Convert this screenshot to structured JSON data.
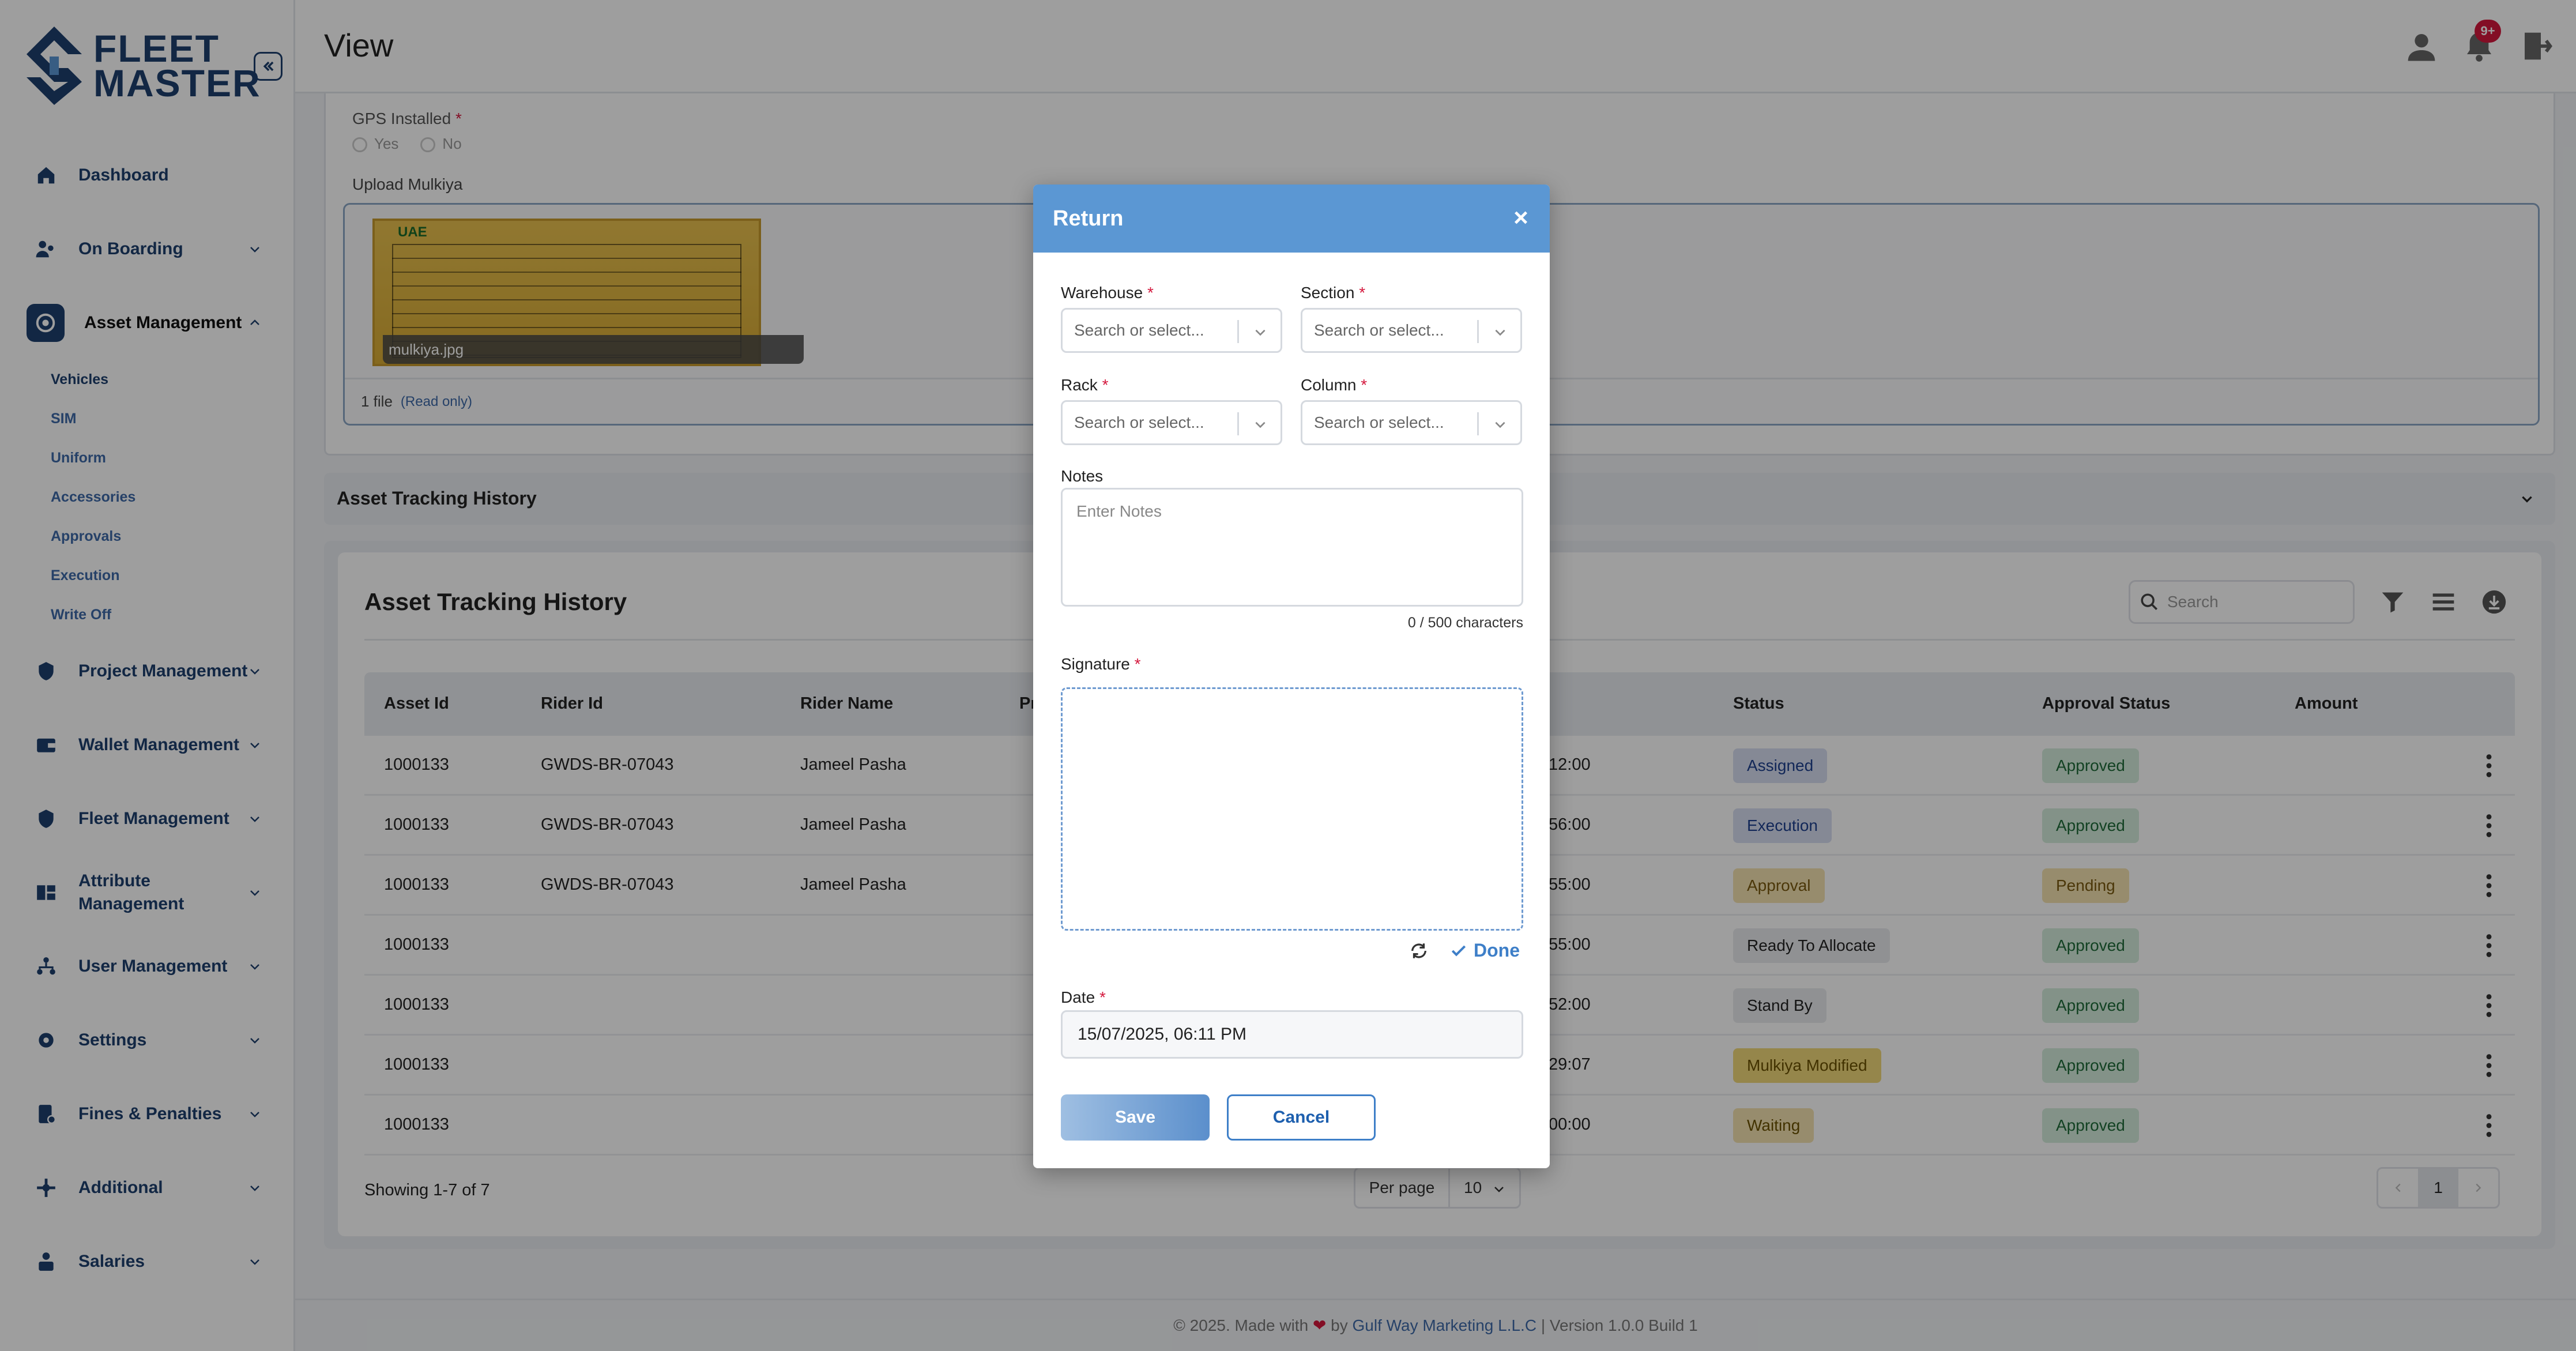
{
  "brand": {
    "line1": "FLEET",
    "line2": "MASTER",
    "color": "#1d3f6e"
  },
  "sidebar": {
    "items": [
      {
        "label": "Dashboard",
        "icon": "home-icon"
      },
      {
        "label": "On Boarding",
        "icon": "people-icon"
      },
      {
        "label": "Asset Management",
        "icon": "asset-icon",
        "expanded": true,
        "children": [
          "Vehicles",
          "SIM",
          "Uniform",
          "Accessories",
          "Approvals",
          "Execution",
          "Write Off"
        ]
      },
      {
        "label": "Project Management",
        "icon": "project-icon"
      },
      {
        "label": "Wallet Management",
        "icon": "wallet-icon"
      },
      {
        "label": "Fleet Management",
        "icon": "fleet-icon"
      },
      {
        "label": "Attribute Management",
        "icon": "attribute-icon"
      },
      {
        "label": "User Management",
        "icon": "user-tree-icon"
      },
      {
        "label": "Settings",
        "icon": "gear-icon"
      },
      {
        "label": "Fines & Penalties",
        "icon": "fines-icon"
      },
      {
        "label": "Additional",
        "icon": "additional-icon"
      },
      {
        "label": "Salaries",
        "icon": "salary-icon"
      }
    ]
  },
  "header": {
    "title": "View",
    "notification_count": "9+"
  },
  "details": {
    "gps_label": "GPS Installed",
    "gps_options": [
      "Yes",
      "No"
    ],
    "upload_label": "Upload Mulkiya",
    "thumb_title": "UAE",
    "file_name": "mulkiya.jpg",
    "file_count": "1 file",
    "read_only": "(Read only)"
  },
  "collapse_section": {
    "title": "Asset Tracking History"
  },
  "table": {
    "title": "Asset Tracking History",
    "search_placeholder": "Search",
    "columns": [
      "Asset Id",
      "Rider Id",
      "Rider Name",
      "Pr",
      "Status",
      "Approval Status",
      "Amount"
    ],
    "rows": [
      {
        "asset_id": "1000133",
        "rider_id": "GWDS-BR-07043",
        "rider_name": "Jameel Pasha",
        "time": "12:00",
        "status": "Assigned",
        "approval": "Approved"
      },
      {
        "asset_id": "1000133",
        "rider_id": "GWDS-BR-07043",
        "rider_name": "Jameel Pasha",
        "time": "56:00",
        "status": "Execution",
        "approval": "Approved"
      },
      {
        "asset_id": "1000133",
        "rider_id": "GWDS-BR-07043",
        "rider_name": "Jameel Pasha",
        "time": "55:00",
        "status": "Approval",
        "approval": "Pending"
      },
      {
        "asset_id": "1000133",
        "rider_id": "",
        "rider_name": "",
        "time": "55:00",
        "status": "Ready To Allocate",
        "approval": "Approved"
      },
      {
        "asset_id": "1000133",
        "rider_id": "",
        "rider_name": "",
        "time": "52:00",
        "status": "Stand By",
        "approval": "Approved"
      },
      {
        "asset_id": "1000133",
        "rider_id": "",
        "rider_name": "",
        "time": "29:07",
        "status": "Mulkiya Modified",
        "approval": "Approved"
      },
      {
        "asset_id": "1000133",
        "rider_id": "",
        "rider_name": "",
        "time": "00:00",
        "status": "Waiting",
        "approval": "Approved"
      }
    ],
    "showing": "Showing 1-7 of 7",
    "per_page_label": "Per page",
    "per_page_value": "10",
    "current_page": "1"
  },
  "status_colors": {
    "Assigned": {
      "bg": "#d7def0",
      "fg": "#1d3f8e"
    },
    "Execution": {
      "bg": "#d7def0",
      "fg": "#1d3f8e"
    },
    "Approval": {
      "bg": "#f4e3b0",
      "fg": "#7a5a10"
    },
    "Ready To Allocate": {
      "bg": "#e9ebee",
      "fg": "#222222"
    },
    "Stand By": {
      "bg": "#e9ebee",
      "fg": "#222222"
    },
    "Mulkiya Modified": {
      "bg": "#f1d97a",
      "fg": "#6b5200"
    },
    "Waiting": {
      "bg": "#f4e3b0",
      "fg": "#6b5200"
    },
    "Approved": {
      "bg": "#d3ecdb",
      "fg": "#1f6b39"
    },
    "Pending": {
      "bg": "#f4e3b0",
      "fg": "#7a5a10"
    }
  },
  "footer": {
    "prefix": "© 2025. Made with",
    "by": "by",
    "company": "Gulf Way Marketing L.L.C",
    "version": "| Version 1.0.0 Build 1"
  },
  "modal": {
    "title": "Return",
    "warehouse_label": "Warehouse",
    "section_label": "Section",
    "rack_label": "Rack",
    "column_label": "Column",
    "select_placeholder": "Search or select...",
    "notes_label": "Notes",
    "notes_placeholder": "Enter Notes",
    "char_count": "0 / 500 characters",
    "signature_label": "Signature",
    "done_label": "Done",
    "date_label": "Date",
    "date_value": "15/07/2025, 06:11 PM",
    "save_label": "Save",
    "cancel_label": "Cancel",
    "header_color": "#5b97d3"
  }
}
